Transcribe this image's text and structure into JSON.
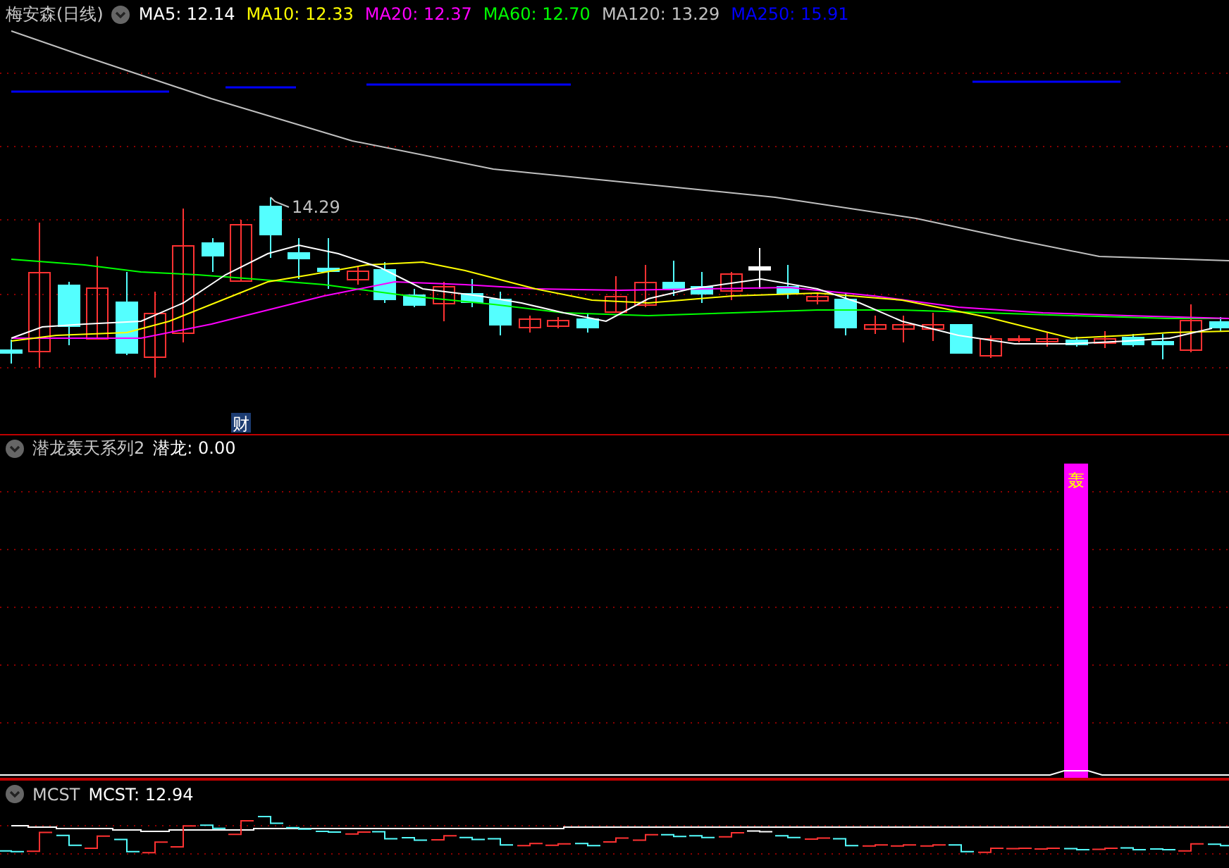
{
  "price_panel": {
    "title": "梅安森(日线)",
    "moving_averages": [
      {
        "label": "MA5: 12.14",
        "color": "#ffffff"
      },
      {
        "label": "MA10: 12.33",
        "color": "#ffff00"
      },
      {
        "label": "MA20: 12.37",
        "color": "#ff00ff"
      },
      {
        "label": "MA60: 12.70",
        "color": "#00ff00"
      },
      {
        "label": "MA120: 13.29",
        "color": "#c0c0c0"
      },
      {
        "label": "MA250: 15.91",
        "color": "#0000ff"
      }
    ],
    "high_label": "14.29",
    "event_badge": "财"
  },
  "indicator_panel": {
    "title": "潜龙轰天系列2",
    "reading": "潜龙: 0.00",
    "signal_label": "轰"
  },
  "mcst_panel": {
    "title": "MCST",
    "reading": "MCST: 12.94"
  }
}
